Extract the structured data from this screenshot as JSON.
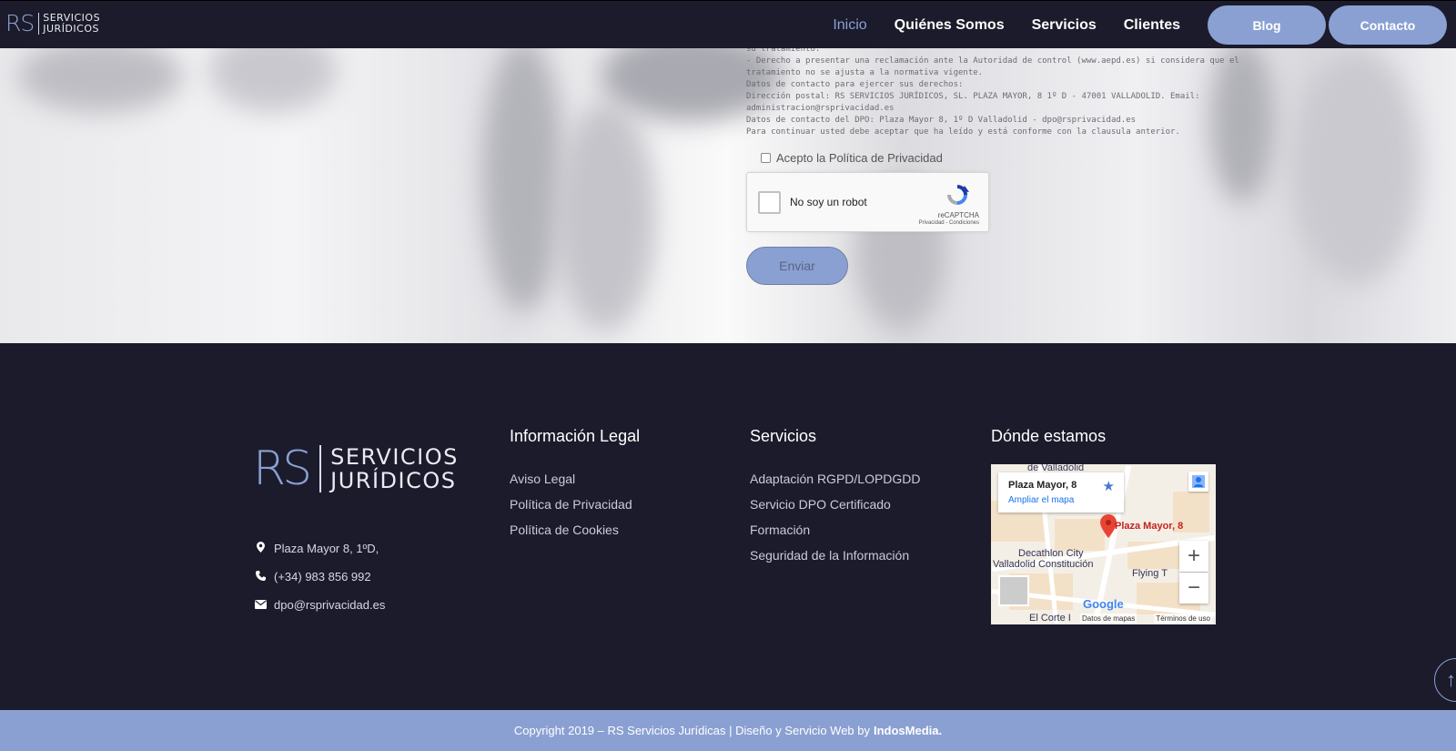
{
  "header": {
    "logo": {
      "mark": "RS",
      "line1": "SERVICIOS",
      "line2": "JURÍDICOS"
    },
    "nav": [
      {
        "label": "Inicio",
        "active": true
      },
      {
        "label": "Quiénes Somos",
        "active": false
      },
      {
        "label": "Servicios",
        "active": false
      },
      {
        "label": "Clientes",
        "active": false
      }
    ],
    "blog_label": "Blog",
    "contact_label": "Contacto"
  },
  "form": {
    "legal_lines": [
      "su tratamiento.",
      "- Derecho a presentar una reclamación ante la Autoridad de control (www.aepd.es) si considera que el",
      "tratamiento no se ajusta a la normativa vigente.",
      "Datos de contacto para ejercer sus derechos:",
      "Dirección postal: RS SERVICIOS JURÍDICOS, SL. PLAZA MAYOR, 8 1º D - 47001 VALLADOLID. Email:",
      "administracion@rsprivacidad.es",
      "Datos de contacto del DPO: Plaza Mayor 8, 1º D Valladolid - dpo@rsprivacidad.es",
      "Para continuar usted debe aceptar que ha leído y está conforme con la clausula anterior."
    ],
    "accept_label": "Acepto la Política de Privacidad",
    "captcha": {
      "label": "No soy un robot",
      "brand": "reCAPTCHA",
      "terms": "Privacidad - Condiciones"
    },
    "submit_label": "Enviar"
  },
  "footer": {
    "logo": {
      "mark": "RS",
      "line1": "SERVICIOS",
      "line2": "JURÍDICOS"
    },
    "contact": {
      "address": "Plaza Mayor 8, 1ºD,",
      "phone": "(+34) 983 856 992",
      "email": "dpo@rsprivacidad.es"
    },
    "legal": {
      "title": "Información Legal",
      "links": [
        "Aviso Legal",
        "Política de Privacidad",
        "Política de Cookies"
      ]
    },
    "services": {
      "title": "Servicios",
      "links": [
        "Adaptación RGPD/LOPDGDD",
        "Servicio DPO Certificado",
        "Formación",
        "Seguridad de la Información"
      ]
    },
    "location": {
      "title": "Dónde estamos",
      "map": {
        "place": "Plaza Mayor, 8",
        "enlarge": "Ampliar el mapa",
        "pin_label": "Plaza Mayor, 8",
        "label_top": "de Valladolid",
        "label_decathlon": "Decathlon City",
        "label_station": "Valladolid Constitución",
        "label_flying": "Flying T",
        "label_corte": "El Corte I",
        "google": "Google",
        "map_data": "Datos de mapas",
        "terms": "Términos de uso",
        "zoom_in": "+",
        "zoom_out": "−"
      }
    }
  },
  "copyright": {
    "text": "Copyright 2019 – RS Servicios Jurídicas  | Diseño y Servicio Web by",
    "brand": "IndosMedia."
  },
  "colors": {
    "navy": "#1b1b2b",
    "accent": "#8aa0d2"
  }
}
